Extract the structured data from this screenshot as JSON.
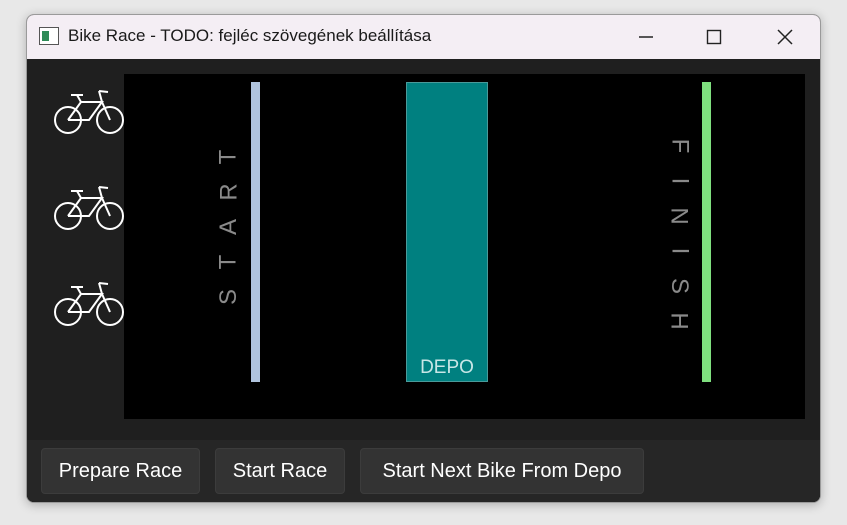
{
  "window": {
    "title": "Bike Race - TODO: fejléc szövegének beállítása"
  },
  "icons": {
    "app": "app-window-icon",
    "minimize": "minimize-icon",
    "maximize": "maximize-icon",
    "close": "close-icon",
    "bike": "bicycle-icon"
  },
  "track": {
    "start_label": "START",
    "finish_label": "FINISH",
    "depo_label": "DEPO",
    "bike_count": 3
  },
  "colors": {
    "start_line": "#b0c4de",
    "finish_line": "#7fe07f",
    "depo_fill": "#008080",
    "track_bg": "#000000"
  },
  "toolbar": {
    "prepare_label": "Prepare Race",
    "start_label": "Start Race",
    "next_bike_label": "Start Next Bike From Depo"
  }
}
